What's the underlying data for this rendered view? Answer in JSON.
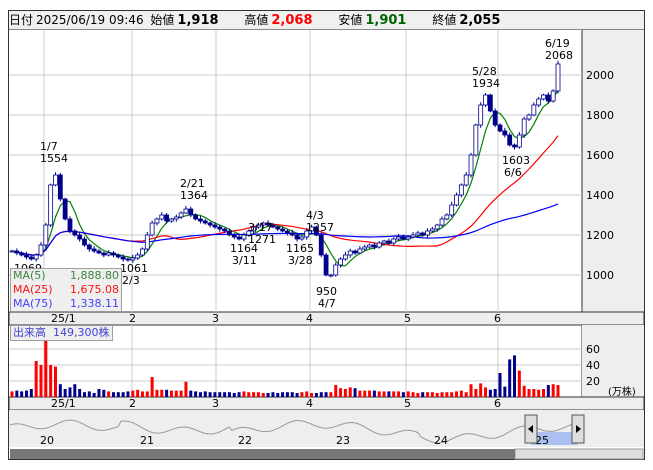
{
  "header": {
    "date_label": "日付",
    "date": "2025/06/19 09:46",
    "open_label": "始値",
    "open": "1,918",
    "high_label": "高値",
    "high": "2,068",
    "low_label": "安値",
    "low": "1,901",
    "close_label": "終値",
    "close": "2,055"
  },
  "colors": {
    "up": "#ff0000",
    "down": "#00008b",
    "ma5": "#008000",
    "ma25": "#ff0000",
    "ma75": "#0000ff",
    "high": "#ff0000",
    "low": "#006400"
  },
  "legend": {
    "ma5_label": "MA(5)",
    "ma5": "1,888.80",
    "ma25_label": "MA(25)",
    "ma25": "1,675.08",
    "ma75_label": "MA(75)",
    "ma75": "1,338.11"
  },
  "volume_legend": {
    "label": "出来高",
    "value": "149,300株"
  },
  "volume_unit": "(万株)",
  "months": [
    "25/1",
    "2",
    "3",
    "4",
    "5",
    "6"
  ],
  "navigator_years": [
    "20",
    "21",
    "22",
    "23",
    "24",
    "25"
  ],
  "chart_data": {
    "type": "candlestick",
    "price_ticks": [
      1000,
      1200,
      1400,
      1600,
      1800,
      2000
    ],
    "volume_ticks": [
      20,
      40,
      60
    ],
    "closes": [
      1120,
      1110,
      1100,
      1090,
      1080,
      1100,
      1150,
      1250,
      1450,
      1500,
      1380,
      1280,
      1220,
      1200,
      1180,
      1150,
      1130,
      1120,
      1110,
      1100,
      1110,
      1100,
      1090,
      1080,
      1075,
      1085,
      1100,
      1130,
      1200,
      1260,
      1280,
      1300,
      1270,
      1280,
      1290,
      1310,
      1330,
      1300,
      1280,
      1270,
      1260,
      1250,
      1240,
      1230,
      1220,
      1200,
      1190,
      1180,
      1200,
      1220,
      1240,
      1250,
      1260,
      1250,
      1240,
      1230,
      1220,
      1210,
      1200,
      1180,
      1190,
      1220,
      1240,
      1200,
      1100,
      1000,
      1000,
      1050,
      1080,
      1100,
      1120,
      1110,
      1130,
      1140,
      1150,
      1140,
      1160,
      1170,
      1160,
      1180,
      1190,
      1180,
      1190,
      1200,
      1210,
      1200,
      1220,
      1230,
      1250,
      1280,
      1300,
      1350,
      1400,
      1450,
      1500,
      1600,
      1750,
      1850,
      1900,
      1820,
      1750,
      1720,
      1700,
      1650,
      1640,
      1700,
      1780,
      1800,
      1850,
      1880,
      1900,
      1870,
      1920,
      2055
    ],
    "volumes": [
      7,
      8,
      7,
      8,
      10,
      45,
      40,
      70,
      40,
      38,
      16,
      10,
      12,
      16,
      10,
      6,
      7,
      5,
      10,
      9,
      7,
      6,
      6,
      6,
      7,
      8,
      9,
      7,
      7,
      25,
      9,
      9,
      9,
      8,
      8,
      8,
      19,
      8,
      7,
      6,
      7,
      6,
      6,
      6,
      6,
      6,
      5,
      6,
      7,
      6,
      6,
      6,
      5,
      5,
      6,
      5,
      6,
      6,
      6,
      5,
      6,
      7,
      5,
      5,
      6,
      6,
      6,
      15,
      11,
      10,
      12,
      11,
      8,
      8,
      8,
      8,
      7,
      7,
      7,
      7,
      7,
      6,
      7,
      6,
      5,
      6,
      6,
      6,
      5,
      6,
      6,
      6,
      7,
      8,
      6,
      16,
      10,
      17,
      12,
      9,
      10,
      30,
      13,
      47,
      52,
      33,
      14,
      10,
      10,
      9,
      10,
      15,
      16,
      15,
      15,
      16,
      15,
      12,
      15,
      10,
      15
    ],
    "annotations": [
      {
        "date": "1/7",
        "price": "1554"
      },
      {
        "date": "",
        "price": "1069"
      },
      {
        "date": "2/3",
        "price": "1061"
      },
      {
        "date": "2/21",
        "price": "1364"
      },
      {
        "date": "3/11",
        "price": "1164"
      },
      {
        "date": "3/17",
        "price": "1271"
      },
      {
        "date": "3/28",
        "price": "1165"
      },
      {
        "date": "4/3",
        "price": "1257"
      },
      {
        "date": "4/7",
        "price": "950"
      },
      {
        "date": "5/28",
        "price": "1934"
      },
      {
        "date": "6/6",
        "price": "1603"
      },
      {
        "date": "6/19",
        "price": "2068"
      }
    ]
  }
}
